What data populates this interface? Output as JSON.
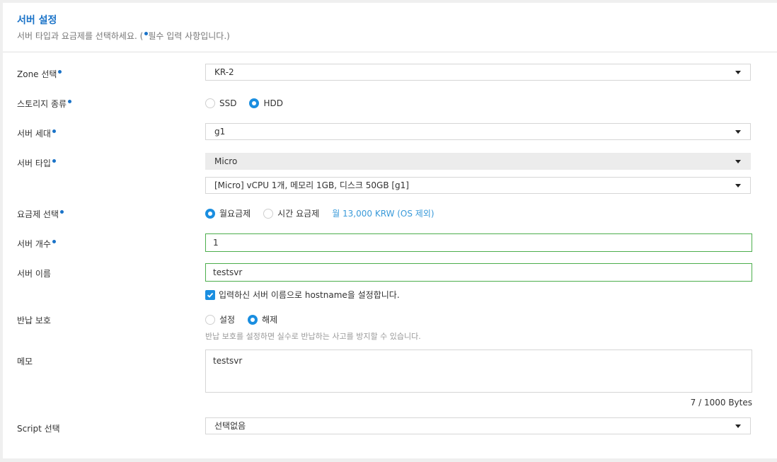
{
  "header": {
    "title": "서버 설정",
    "subtitle_prefix": "서버 타입과 요금제를 선택하세요. (",
    "subtitle_suffix": "필수 입력 사항입니다.)"
  },
  "fields": {
    "zone": {
      "label": "Zone 선택",
      "value": "KR-2"
    },
    "storage": {
      "label": "스토리지 종류",
      "options": [
        "SSD",
        "HDD"
      ],
      "selected": "HDD"
    },
    "generation": {
      "label": "서버 세대",
      "value": "g1"
    },
    "server_type": {
      "label": "서버 타입",
      "type_value": "Micro",
      "spec_value": "[Micro] vCPU 1개, 메모리 1GB, 디스크 50GB [g1]"
    },
    "plan": {
      "label": "요금제 선택",
      "options": [
        "월요금제",
        "시간 요금제"
      ],
      "selected": "월요금제",
      "price": "월 13,000 KRW (OS 제외)"
    },
    "count": {
      "label": "서버 개수",
      "value": "1"
    },
    "name": {
      "label": "서버 이름",
      "value": "testsvr",
      "hostname_checkbox_label": "입력하신 서버 이름으로 hostname을 설정합니다.",
      "hostname_checked": true
    },
    "return_protection": {
      "label": "반납 보호",
      "options": [
        "설정",
        "해제"
      ],
      "selected": "해제",
      "hint": "반납 보호를 설정하면 실수로 반납하는 사고를 방지할 수 있습니다."
    },
    "memo": {
      "label": "메모",
      "value": "testsvr",
      "byte_count": "7 / 1000 Bytes"
    },
    "script": {
      "label": "Script 선택",
      "value": "선택없음"
    }
  },
  "colors": {
    "accent": "#1a73c8",
    "radio": "#1a8ee0",
    "valid_border": "#4cae4c",
    "price": "#3a9ad9"
  }
}
